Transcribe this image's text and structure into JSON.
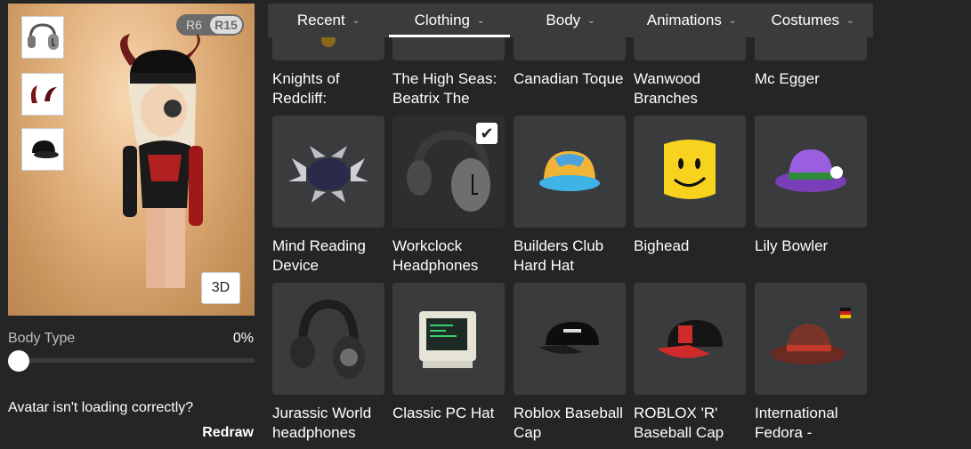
{
  "preview": {
    "rig_options": [
      "R6",
      "R15"
    ],
    "rig_selected": "R15",
    "view_button": "3D",
    "worn_items": [
      {
        "icon": "headphones-icon"
      },
      {
        "icon": "horns-icon"
      },
      {
        "icon": "cap-icon"
      }
    ]
  },
  "body_type": {
    "label": "Body Type",
    "value": "0%",
    "level": 0
  },
  "loading": {
    "question": "Avatar isn't loading correctly?",
    "redraw": "Redraw"
  },
  "tabs": [
    {
      "label": "Recent"
    },
    {
      "label": "Clothing"
    },
    {
      "label": "Body"
    },
    {
      "label": "Animations"
    },
    {
      "label": "Costumes"
    }
  ],
  "active_tab": "Clothing",
  "items": [
    {
      "name": "Knights of Redcliff:",
      "icon": "knight-helmet-icon"
    },
    {
      "name": "The High Seas: Beatrix The",
      "icon": "pirate-hat-icon"
    },
    {
      "name": "Canadian Toque",
      "icon": "toque-icon"
    },
    {
      "name": "Wanwood Branches",
      "icon": "branches-icon"
    },
    {
      "name": "Mc Egger",
      "icon": "egg-hat-icon"
    },
    {
      "name": "Mind Reading Device",
      "icon": "mind-reading-device-icon"
    },
    {
      "name": "Workclock Headphones",
      "icon": "workclock-headphones-icon",
      "selected": true
    },
    {
      "name": "Builders Club Hard Hat",
      "icon": "hard-hat-icon"
    },
    {
      "name": "Bighead",
      "icon": "bighead-icon"
    },
    {
      "name": "Lily Bowler",
      "icon": "lily-bowler-icon"
    },
    {
      "name": "Jurassic World headphones",
      "icon": "jurassic-headphones-icon"
    },
    {
      "name": "Classic PC Hat",
      "icon": "pc-hat-icon"
    },
    {
      "name": "Roblox Baseball Cap",
      "icon": "roblox-cap-icon"
    },
    {
      "name": "ROBLOX 'R' Baseball Cap",
      "icon": "r-cap-icon"
    },
    {
      "name": "International Fedora -",
      "icon": "fedora-icon"
    }
  ],
  "colors": {
    "background": "#232527",
    "card": "#393b3d",
    "accent_yellow": "#f7d21e",
    "cap_red": "#d02b2b",
    "bowler_purple": "#7a3fb8"
  }
}
